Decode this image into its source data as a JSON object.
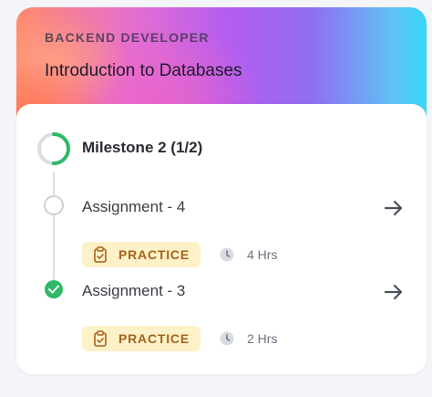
{
  "course": {
    "track": "BACKEND DEVELOPER",
    "title": "Introduction to Databases"
  },
  "milestone": {
    "title": "Milestone 2 (1/2)",
    "progress": 0.5
  },
  "steps": [
    {
      "title": "Assignment - 4",
      "status": "not-started",
      "badge": "PRACTICE",
      "duration": "4 Hrs"
    },
    {
      "title": "Assignment - 3",
      "status": "completed",
      "badge": "PRACTICE",
      "duration": "2 Hrs"
    }
  ],
  "colors": {
    "progress_green": "#2fb968",
    "badge_bg": "#fdf1c8",
    "badge_text": "#a8611b"
  },
  "icons": {
    "step_action": "arrow-right-icon",
    "badge": "clipboard-check-icon",
    "duration": "clock-icon"
  }
}
